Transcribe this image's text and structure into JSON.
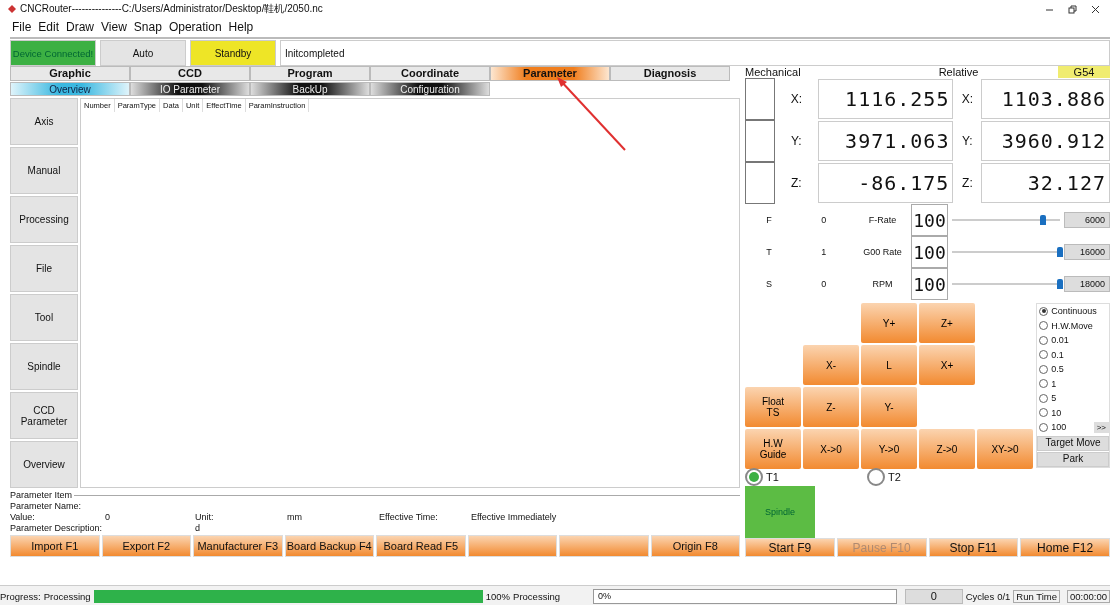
{
  "window": {
    "title": "CNCRouter---------------C:/Users/Administrator/Desktop/鞋机/2050.nc"
  },
  "menu": [
    "File",
    "Edit",
    "Draw",
    "View",
    "Snap",
    "Operation",
    "Help"
  ],
  "status_row": [
    {
      "label": "Device Connected!",
      "kind": "ok"
    },
    {
      "label": "Auto",
      "kind": "plain"
    },
    {
      "label": "Standby",
      "kind": "warn"
    }
  ],
  "message": "Initcompleted",
  "tabs": [
    {
      "label": "Graphic",
      "selected": false
    },
    {
      "label": "CCD",
      "selected": false
    },
    {
      "label": "Program",
      "selected": false
    },
    {
      "label": "Coordinate",
      "selected": false
    },
    {
      "label": "Parameter",
      "selected": true
    },
    {
      "label": "Diagnosis",
      "selected": false
    }
  ],
  "subtabs": [
    {
      "label": "Overview",
      "selected": true
    },
    {
      "label": "IO Parameter",
      "selected": false
    },
    {
      "label": "BackUp",
      "selected": false
    },
    {
      "label": "Configuration",
      "selected": false
    }
  ],
  "sidebar": [
    "Axis",
    "Manual",
    "Processing",
    "File",
    "Tool",
    "Spindle",
    "CCD\nParameter",
    "Overview"
  ],
  "table": {
    "columns": [
      "Number",
      "ParamType",
      "Data",
      "Unit",
      "EffectTime",
      "ParamInstruction"
    ]
  },
  "param_item": {
    "title": "Parameter Item",
    "name_label": "Parameter Name:",
    "value_label": "Value:",
    "value": "0",
    "unit_label": "Unit:",
    "unit": "mm",
    "effective_label": "Effective Time:",
    "effective": "Effective Immediately",
    "description_label": "Parameter Description:",
    "description": "d"
  },
  "function_buttons": [
    {
      "kind": "label",
      "label": "Import F1"
    },
    {
      "kind": "label",
      "label": "Export F2"
    },
    {
      "kind": "label",
      "label": "Manufacturer F3"
    },
    {
      "kind": "label",
      "label": "Board Backup F4"
    },
    {
      "kind": "label",
      "label": "Board Read F5"
    },
    {
      "kind": "blank"
    },
    {
      "kind": "blank"
    },
    {
      "kind": "label",
      "label": "Origin F8"
    }
  ],
  "coords": {
    "mechanical_label": "Mechanical",
    "relative_label": "Relative",
    "system": "G54",
    "rows": [
      {
        "axis": "X:",
        "mechanical": "1116.255",
        "relative_axis": "X:",
        "relative": "1103.886"
      },
      {
        "axis": "Y:",
        "mechanical": "3971.063",
        "relative_axis": "Y:",
        "relative": "3960.912"
      },
      {
        "axis": "Z:",
        "mechanical": "-86.175",
        "relative_axis": "Z:",
        "relative": "32.127"
      }
    ]
  },
  "rates": [
    {
      "letter": "F",
      "value": "0",
      "name": "F-Rate",
      "percent": "100",
      "level": 0.84,
      "reading": "6000"
    },
    {
      "letter": "T",
      "value": "1",
      "name": "G00 Rate",
      "percent": "100",
      "level": 1,
      "reading": "16000"
    },
    {
      "letter": "S",
      "value": "0",
      "name": "RPM",
      "percent": "100",
      "level": 1,
      "reading": "18000"
    }
  ],
  "jog_rows": [
    [
      null,
      null,
      "Y+",
      "Z+",
      null
    ],
    [
      null,
      "X-",
      "L",
      "X+",
      null
    ],
    [
      "Float\nTS",
      "Z-",
      "Y-",
      null,
      null
    ],
    [
      "H.W\nGuide",
      "X->0",
      "Y->0",
      "Z->0",
      "XY->0"
    ]
  ],
  "step_modes": [
    {
      "label": "Continuous",
      "selected": true
    },
    {
      "label": "H.W.Move",
      "selected": false
    },
    {
      "label": "0.01",
      "selected": false
    },
    {
      "label": "0.1",
      "selected": false
    },
    {
      "label": "0.5",
      "selected": false
    },
    {
      "label": "1",
      "selected": false
    },
    {
      "label": "5",
      "selected": false
    },
    {
      "label": "10",
      "selected": false
    },
    {
      "label": "100",
      "selected": false
    }
  ],
  "more_button": ">>",
  "side_buttons": [
    "Target Move",
    "Park"
  ],
  "tools": [
    {
      "label": "T1",
      "selected": true
    },
    {
      "label": "T2",
      "selected": false
    }
  ],
  "spindle": {
    "label": "Spindle",
    "on": true
  },
  "run_buttons": [
    {
      "label": "Start F9",
      "disabled": false
    },
    {
      "label": "Pause F10",
      "disabled": true
    },
    {
      "label": "Stop F11",
      "disabled": false
    },
    {
      "label": "Home F12",
      "disabled": false
    }
  ],
  "status_bar": {
    "progress_label": "Progress:",
    "progress_state": "Processing",
    "level": 1,
    "percent": "100%",
    "state": "Processing",
    "job_progress": {
      "text": "0%",
      "level": 0
    },
    "count": "0",
    "cycles_label": "Cycles",
    "cycles": "0/1",
    "run_time_label": "Run Time",
    "run_time": "00:00:00"
  }
}
